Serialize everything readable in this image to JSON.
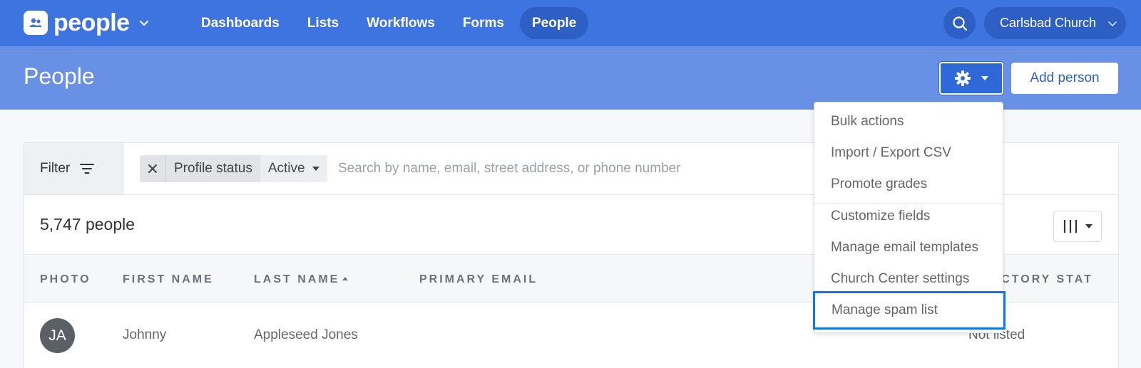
{
  "app": {
    "name": "people",
    "brand_color": "#3e74e0"
  },
  "nav": {
    "items": [
      {
        "label": "Dashboards",
        "active": false
      },
      {
        "label": "Lists",
        "active": false
      },
      {
        "label": "Workflows",
        "active": false
      },
      {
        "label": "Forms",
        "active": false
      },
      {
        "label": "People",
        "active": true
      }
    ],
    "org_name": "Carlsbad Church"
  },
  "page": {
    "title": "People",
    "add_button": "Add person"
  },
  "filter": {
    "label": "Filter",
    "chip": {
      "field": "Profile status",
      "value": "Active"
    },
    "search_placeholder": "Search by name, email, street address, or phone number"
  },
  "results": {
    "count": "5,747 people"
  },
  "table": {
    "columns": [
      "PHOTO",
      "FIRST NAME",
      "LAST NAME",
      "PRIMARY EMAIL",
      "DIRECTORY STATUS"
    ],
    "visible_header_fragments": {
      "directory_status": "RECTORY STAT"
    },
    "rows": [
      {
        "initials": "JA",
        "first_name": "Johnny",
        "last_name": "Appleseed Jones",
        "primary_email": "",
        "directory_status": "Not listed",
        "visible_status_fragment": "Not listed"
      }
    ]
  },
  "settings_menu": {
    "items": [
      {
        "label": "Bulk actions"
      },
      {
        "label": "Import / Export CSV"
      },
      {
        "label": "Promote grades"
      },
      {
        "label": "Customize fields"
      },
      {
        "label": "Manage email templates"
      },
      {
        "label": "Church Center settings"
      },
      {
        "label": "Manage spam list",
        "highlighted": true
      }
    ],
    "highlight_color": "#1273eb"
  }
}
